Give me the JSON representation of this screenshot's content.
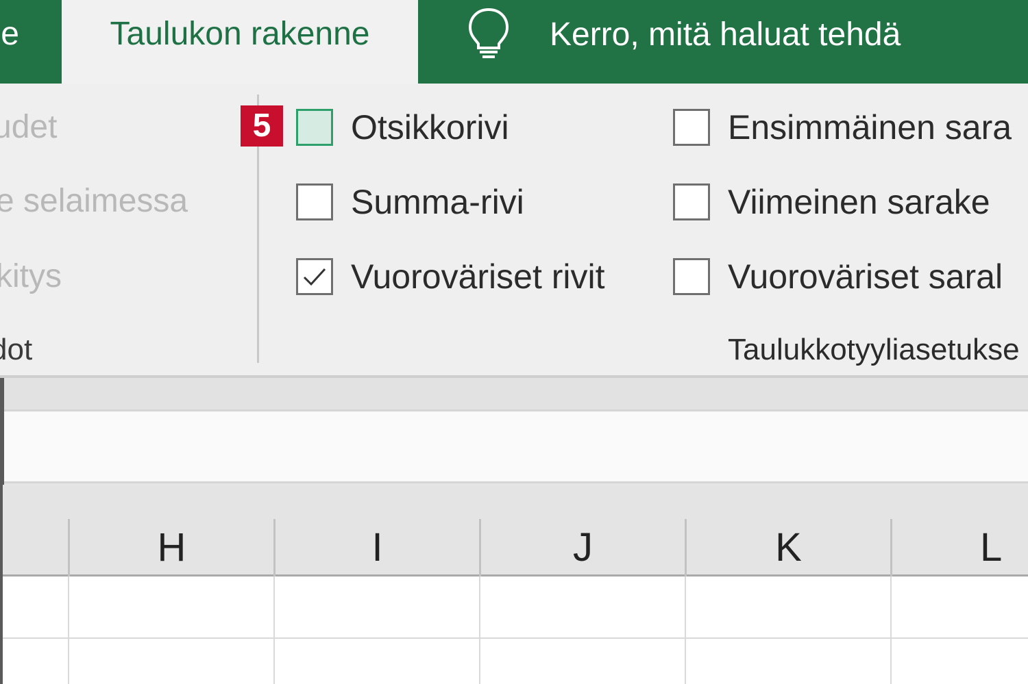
{
  "tabs": {
    "partial_label": "e",
    "active_label": "Taulukon rakenne",
    "tellme_text": "Kerro, mitä haluat tehdä",
    "tellme_icon": "lightbulb-icon"
  },
  "ribbon_left": {
    "line1": "udet",
    "line2": "e selaimessa",
    "line3": "kitys",
    "group_label": "dot"
  },
  "step_badge": "5",
  "style_options": {
    "header_row": {
      "label": "Otsikkorivi",
      "checked": false
    },
    "total_row": {
      "label": "Summa-rivi",
      "checked": false
    },
    "banded_rows": {
      "label": "Vuoroväriset rivit",
      "checked": true
    },
    "first_column": {
      "label": "Ensimmäinen sara",
      "checked": false
    },
    "last_column": {
      "label": "Viimeinen sarake",
      "checked": false
    },
    "banded_columns": {
      "label": "Vuoroväriset saral",
      "checked": false
    },
    "group_label": "Taulukkotyyliasetukse"
  },
  "columns": [
    "H",
    "I",
    "J",
    "K",
    "L"
  ],
  "colors": {
    "ribbon_green": "#217346",
    "active_tab_text": "#1e7145",
    "badge_red": "#c8102e"
  }
}
